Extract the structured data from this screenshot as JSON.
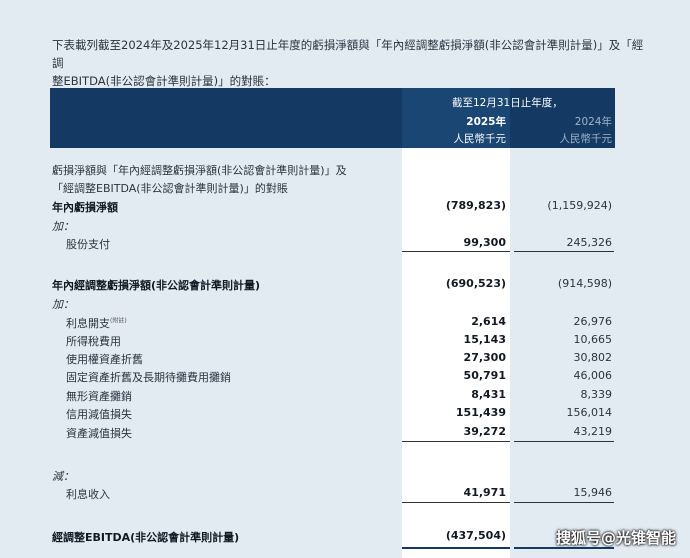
{
  "intro": {
    "line1": "下表載列截至2024年及2025年12月31日止年度的虧損淨額與「年內經調整虧損淨額(非公認會計準則計量)」及「經調",
    "line2": "整EBITDA(非公認會計準則計量)」的對賬："
  },
  "header": {
    "period": "截至12月31日止年度，",
    "year_current": "2025年",
    "year_prior": "2024年",
    "unit_current": "人民幣千元",
    "unit_prior": "人民幣千元"
  },
  "rows": [
    {
      "label": "虧損淨額與「年內經調整虧損淨額(非公認會計準則計量)」及"
    },
    {
      "label": "「經調整EBITDA(非公認會計準則計量)」的對賬"
    },
    {
      "label": "年內虧損淨額",
      "current": "(789,823)",
      "prior": "(1,159,924)"
    },
    {
      "label": "加："
    },
    {
      "label": "股份支付",
      "current": "99,300",
      "prior": "245,326"
    },
    {
      "label": "年內經調整虧損淨額(非公認會計準則計量)",
      "current": "(690,523)",
      "prior": "(914,598)"
    },
    {
      "label": "加："
    },
    {
      "label": "利息開支",
      "note": "(附註)",
      "current": "2,614",
      "prior": "26,976"
    },
    {
      "label": "所得稅費用",
      "current": "15,143",
      "prior": "10,665"
    },
    {
      "label": "使用權資產折舊",
      "current": "27,300",
      "prior": "30,802"
    },
    {
      "label": "固定資產折舊及長期待攤費用攤銷",
      "current": "50,791",
      "prior": "46,006"
    },
    {
      "label": "無形資產攤銷",
      "current": "8,431",
      "prior": "8,339"
    },
    {
      "label": "信用減值損失",
      "current": "151,439",
      "prior": "156,014"
    },
    {
      "label": "資產減值損失",
      "current": "39,272",
      "prior": "43,219"
    },
    {
      "label": "減："
    },
    {
      "label": "利息收入",
      "current": "41,971",
      "prior": "15,946"
    },
    {
      "label": "經調整EBITDA(非公認會計準則計量)",
      "current": "(437,504)",
      "prior": ""
    }
  ],
  "watermark": "搜狐号@光锥智能",
  "colors": {
    "header_bg": "#143a63",
    "page_bg": "#e3ebf2"
  }
}
